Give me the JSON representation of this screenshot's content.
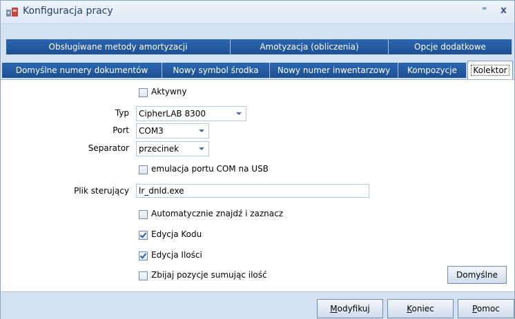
{
  "window": {
    "title": "Konfiguracja pracy",
    "help_glyph": "⁼",
    "close_glyph": "x"
  },
  "tabs": {
    "row1": [
      {
        "label": "Obsługiwane metody amortyzacji"
      },
      {
        "label": "Amotyzacja (obliczenia)"
      },
      {
        "label": "Opcje dodatkowe"
      }
    ],
    "row2": [
      {
        "label": "Domyślne numery dokumentów"
      },
      {
        "label": "Nowy symbol środka"
      },
      {
        "label": "Nowy numer inwentarzowy"
      },
      {
        "label": "Kompozycje"
      },
      {
        "label": "Kolektor"
      }
    ]
  },
  "form": {
    "aktywny": {
      "label": "Aktywny",
      "checked": false
    },
    "typ": {
      "label": "Typ",
      "value": "CipherLAB 8300"
    },
    "port": {
      "label": "Port",
      "value": "COM3"
    },
    "separator": {
      "label": "Separator",
      "value": "przecinek"
    },
    "emulacja": {
      "label": "emulacja portu COM na USB",
      "checked": false
    },
    "plik": {
      "label": "Plik sterujący",
      "value": "lr_dnld.exe"
    },
    "auto": {
      "label": "Automatycznie znajdź i zaznacz",
      "checked": false
    },
    "edycja_kodu": {
      "label": "Edycja Kodu",
      "checked": true
    },
    "edycja_ilosci": {
      "label": "Edycja Ilości",
      "checked": true
    },
    "zbijaj": {
      "label": "Zbijaj pozycje sumując ilość",
      "checked": false
    },
    "domyslne_button": "Domyślne"
  },
  "footer": {
    "modyfikuj": {
      "accel": "M",
      "rest": "odyfikuj"
    },
    "koniec": {
      "accel": "K",
      "rest": "oniec"
    },
    "pomoc": {
      "accel": "P",
      "rest": "omoc"
    }
  }
}
